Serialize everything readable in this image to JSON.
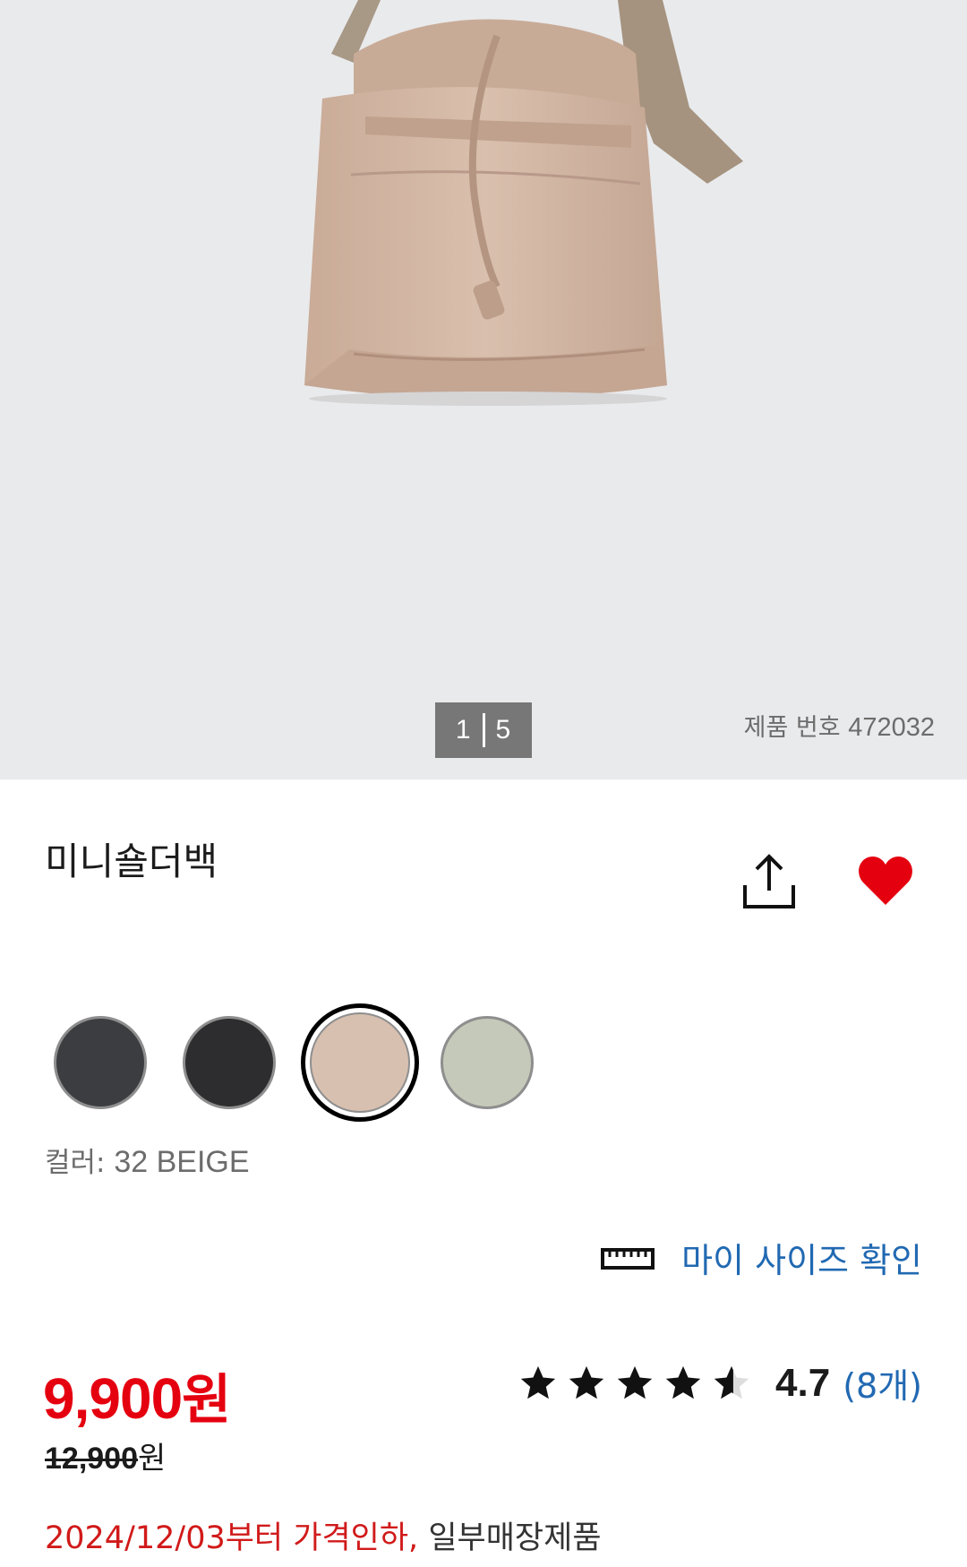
{
  "gallery": {
    "image_alt": "beige mini shoulder bag",
    "pager_current": "1",
    "pager_total": "5",
    "product_no_label": "제품 번호",
    "product_no": "472032"
  },
  "product": {
    "title": "미니숄더백",
    "share_icon": "share-icon",
    "favorite_icon": "heart-icon",
    "favorite_color": "#e50010"
  },
  "colors": {
    "swatches": [
      {
        "name": "dark-gray",
        "hex": "#3b3d40"
      },
      {
        "name": "black",
        "hex": "#2d2d2f"
      },
      {
        "name": "beige",
        "hex": "#d8c0b0",
        "selected": true
      },
      {
        "name": "light-green",
        "hex": "#c5c9b9"
      }
    ],
    "label": "컬러:",
    "selected_value": "32 BEIGE"
  },
  "size": {
    "icon": "ruler-icon",
    "link_label": "마이 사이즈 확인",
    "link_color": "#2169b2"
  },
  "price": {
    "current": "9,900",
    "current_unit": "원",
    "original": "12,900",
    "original_unit": "원",
    "accent": "#e50010"
  },
  "rating": {
    "stars": 4.7,
    "value": "4.7",
    "count_label": "(8개)"
  },
  "notice": {
    "price_drop": "2024/12/03부터 가격인하,",
    "store_note": "일부매장제품"
  }
}
